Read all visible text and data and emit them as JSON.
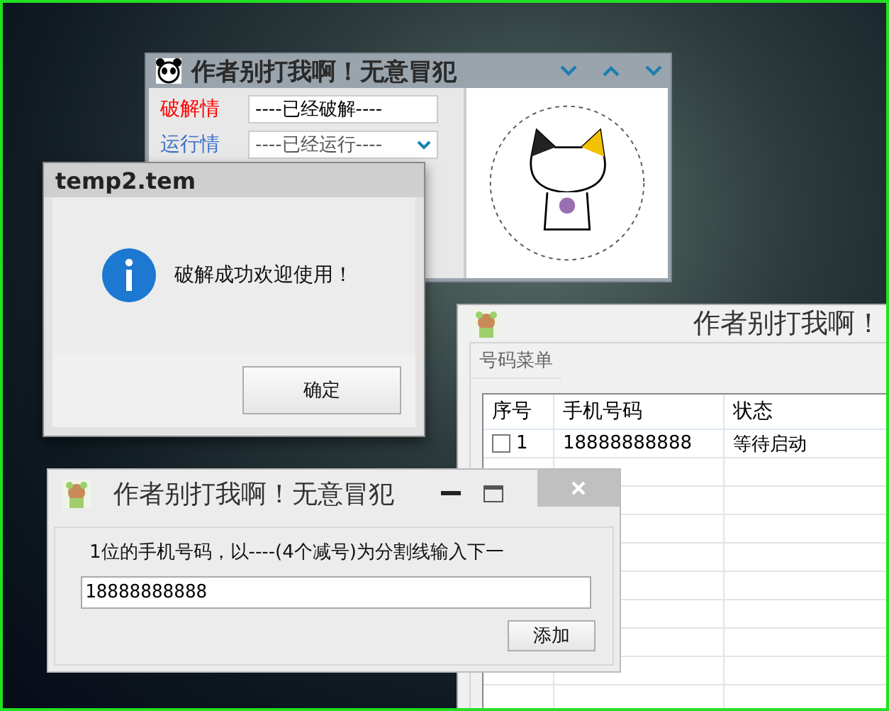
{
  "main_window": {
    "title": "作者别打我啊！无意冒犯",
    "rows": [
      {
        "kind": "field",
        "label": "破解情",
        "value": "----已经破解----",
        "color": "#ff0000"
      },
      {
        "kind": "dropdown",
        "label": "运行情",
        "value": "----已经运行----",
        "color": "#3f73c8"
      }
    ]
  },
  "message_dialog": {
    "title": "temp2.tem",
    "message": "破解成功欢迎使用！",
    "button": "确定"
  },
  "number_window": {
    "title": "作者别打我啊！",
    "group": "号码菜单",
    "columns": [
      "序号",
      "手机号码",
      "状态"
    ],
    "rows": [
      {
        "checked": false,
        "cells": [
          "1",
          "18888888888",
          "等待启动"
        ]
      }
    ]
  },
  "input_window": {
    "title": "作者别打我啊！无意冒犯",
    "instruction": "1位的手机号码，以----(4个减号)为分割线输入下一",
    "value": "18888888888",
    "button": "添加"
  }
}
